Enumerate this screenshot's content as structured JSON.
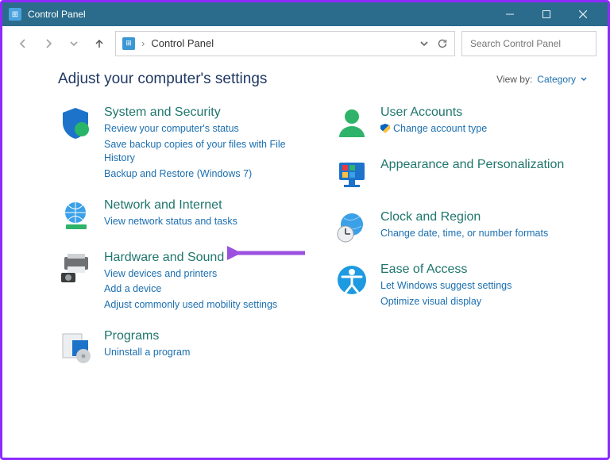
{
  "window": {
    "title": "Control Panel"
  },
  "address": {
    "crumb": "Control Panel"
  },
  "search": {
    "placeholder": "Search Control Panel"
  },
  "heading": "Adjust your computer's settings",
  "viewby": {
    "label": "View by:",
    "value": "Category"
  },
  "left": [
    {
      "title": "System and Security",
      "links": [
        "Review your computer's status",
        "Save backup copies of your files with File History",
        "Backup and Restore (Windows 7)"
      ]
    },
    {
      "title": "Network and Internet",
      "links": [
        "View network status and tasks"
      ]
    },
    {
      "title": "Hardware and Sound",
      "links": [
        "View devices and printers",
        "Add a device",
        "Adjust commonly used mobility settings"
      ]
    },
    {
      "title": "Programs",
      "links": [
        "Uninstall a program"
      ]
    }
  ],
  "right": [
    {
      "title": "User Accounts",
      "links": [
        "Change account type"
      ],
      "shield": [
        true
      ]
    },
    {
      "title": "Appearance and Personalization",
      "links": []
    },
    {
      "title": "Clock and Region",
      "links": [
        "Change date, time, or number formats"
      ]
    },
    {
      "title": "Ease of Access",
      "links": [
        "Let Windows suggest settings",
        "Optimize visual display"
      ]
    }
  ]
}
